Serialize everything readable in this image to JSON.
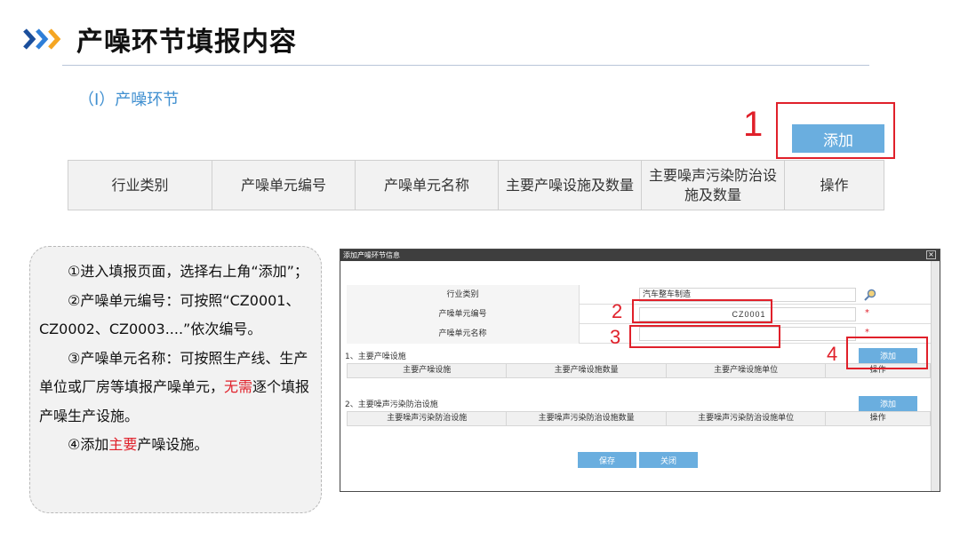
{
  "header": {
    "title": "产噪环节填报内容",
    "section_label": "（I）产噪环节",
    "add_label": "添加",
    "step_marker": "1"
  },
  "table": {
    "columns": [
      "行业类别",
      "产噪单元编号",
      "产噪单元名称",
      "主要产噪设施及数量",
      "主要噪声污染防治设施及数量",
      "操作"
    ]
  },
  "notes": {
    "p1": "①进入填报页面，选择右上角“添加”；",
    "p2": "②产噪单元编号：可按照“CZ0001、CZ0002、CZ0003....”依次编号。",
    "p3_a": "③产噪单元名称：可按照生产线、生产单位或厂房等填报产噪单元，",
    "p3_red": "无需",
    "p3_b": "逐个填报产噪生产设施。",
    "p4_a": "④添加",
    "p4_red": "主要",
    "p4_b": "产噪设施。"
  },
  "dialog": {
    "title": "添加产噪环节信息",
    "close": "×",
    "fields": [
      {
        "label": "行业类别",
        "value": "汽车整车制造"
      },
      {
        "label": "产噪单元编号",
        "value": "CZ0001"
      },
      {
        "label": "产噪单元名称",
        "value": ""
      }
    ],
    "required_mark": "*",
    "markers": [
      "2",
      "3",
      "4"
    ],
    "section1": {
      "title": "1、主要产噪设施",
      "add_label": "添加",
      "columns": [
        "主要产噪设施",
        "主要产噪设施数量",
        "主要产噪设施单位",
        "操作"
      ]
    },
    "section2": {
      "title": "2、主要噪声污染防治设施",
      "add_label": "添加",
      "columns": [
        "主要噪声污染防治设施",
        "主要噪声污染防治设施数量",
        "主要噪声污染防治设施单位",
        "操作"
      ]
    },
    "save_label": "保存",
    "close_label": "关闭"
  },
  "colors": {
    "accent_blue": "#6aaedf",
    "heading_blue": "#3f8fd0",
    "highlight_red": "#e0202a",
    "chevron_dark": "#1b4f9c",
    "chevron_orange": "#f5a623"
  }
}
